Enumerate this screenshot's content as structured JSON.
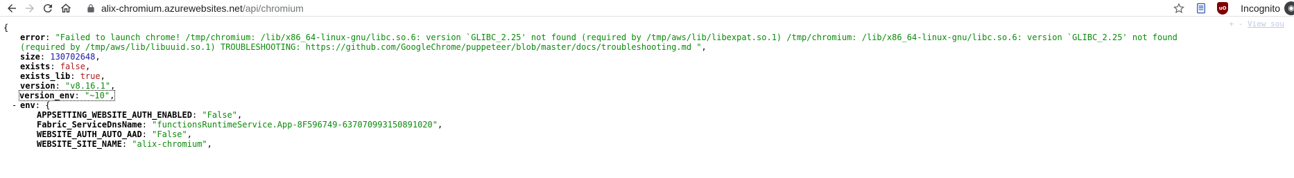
{
  "browser": {
    "url_host": "alix-chromium.azurewebsites.net",
    "url_path": "/api/chromium",
    "incognito_label": "Incognito",
    "extension_badge": "uO"
  },
  "viewer": {
    "view_source_expand": "+ -",
    "view_source_link": "View sou",
    "open_brace": "{",
    "collapse_toggle": "-",
    "fields": {
      "error": {
        "key": "error",
        "value_line1": "\"Failed to launch chrome! /tmp/chromium: /lib/x86_64-linux-gnu/libc.so.6: version `GLIBC_2.25' not found (required by /tmp/aws/lib/libexpat.so.1) /tmp/chromium: /lib/x86_64-linux-gnu/libc.so.6: version `GLIBC_2.25' not found",
        "value_line2": "(required by /tmp/aws/lib/libuuid.so.1) TROUBLESHOOTING: https://github.com/GoogleChrome/puppeteer/blob/master/docs/troubleshooting.md \""
      },
      "size": {
        "key": "size",
        "value": "130702648"
      },
      "exists": {
        "key": "exists",
        "value": "false"
      },
      "exists_lib": {
        "key": "exists_lib",
        "value": "true"
      },
      "version": {
        "key": "version",
        "value": "\"v8.16.1\""
      },
      "version_env": {
        "key": "version_env",
        "value": "\"~10\""
      },
      "env": {
        "key": "env",
        "open": "{",
        "entries": [
          {
            "key": "APPSETTING_WEBSITE_AUTH_ENABLED",
            "value": "\"False\""
          },
          {
            "key": "Fabric_ServiceDnsName",
            "value": "\"functionsRuntimeService.App-8F596749-637070993150891020\""
          },
          {
            "key": "WEBSITE_AUTH_AUTO_AAD",
            "value": "\"False\""
          },
          {
            "key": "WEBSITE_SITE_NAME",
            "value": "\"alix-chromium\""
          }
        ]
      }
    }
  }
}
